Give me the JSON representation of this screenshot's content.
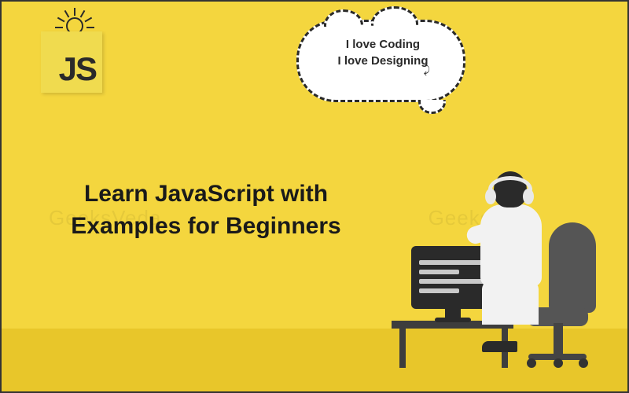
{
  "logo": {
    "text": "JS"
  },
  "headline": "Learn JavaScript with Examples for Beginners",
  "speech_bubble": {
    "line1": "I love Coding",
    "line2": "I love Designing"
  },
  "watermark": "GeeksVeda",
  "colors": {
    "background": "#f4d63e",
    "floor": "#e8c62a",
    "text": "#1a1a1a",
    "js_logo_bg": "#f0db4f"
  }
}
